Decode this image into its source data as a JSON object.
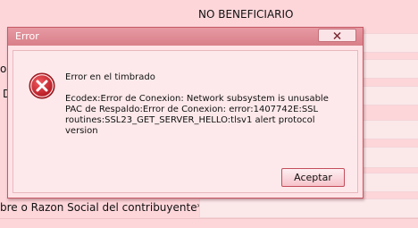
{
  "background": {
    "title": "NO BENEFICIARIO",
    "label_left_1": "o",
    "label_left_2": "D",
    "taxpayer_label": "bre o Razon Social del contribuyente*"
  },
  "dialog": {
    "title": "Error",
    "close_icon": "close-icon",
    "icon": "error-icon",
    "heading": "Error en el timbrado",
    "message_lines": [
      "Ecodex:Error de Conexion: Network subsystem is unusable",
      "PAC de Respaldo:Error de Conexion: error:1407742E:SSL",
      "routines:SSL23_GET_SERVER_HELLO:tlsv1 alert protocol",
      "version"
    ],
    "ok_label": "Aceptar",
    "colors": {
      "titlebar": "#d97f89",
      "accent_border": "#c44d5b",
      "error_icon": "#c8232c"
    }
  }
}
